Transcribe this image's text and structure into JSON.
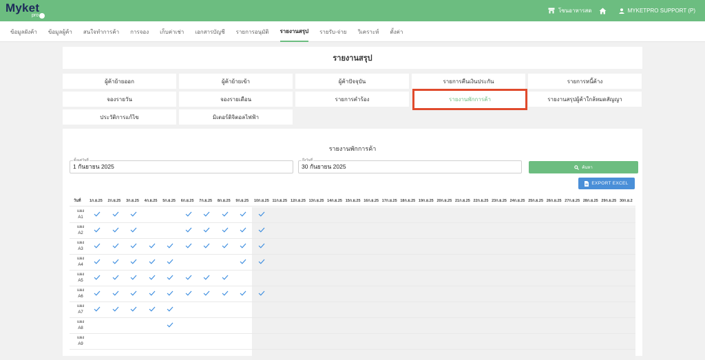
{
  "brand": {
    "name": "Myket",
    "sub": "pro"
  },
  "topbar": {
    "shop_label": "โซนอาหารสด",
    "user_label": "MYKETPRO SUPPORT (P)"
  },
  "nav": [
    "ข้อมูลผังค้า",
    "ข้อมูลผู้ค้า",
    "สนใจทำการค้า",
    "การจอง",
    "เก็บค่าเช่า",
    "เอกสารบัญชี",
    "รายการอนุมัติ",
    "รายงานสรุป",
    "รายรับ-จ่าย",
    "วิเคราะห์",
    "ตั้งค่า"
  ],
  "nav_active": 7,
  "page_title": "รายงานสรุป",
  "report_buttons": [
    "ผู้ค้าย้ายออก",
    "ผู้ค้าย้ายเข้า",
    "ผู้ค้าปัจจุบัน",
    "รายการคืนเงินประกัน",
    "รายการหนี้ค้าง",
    "จองรายวัน",
    "จองรายเดือน",
    "รายการคำร้อง",
    "รายงานพักการค้า",
    "รายงานสรุปผู้ค้าใกล้หมดสัญญา",
    "ประวัติการแก้ไข",
    "มิเตอร์ดิจิตอลไฟฟ้า"
  ],
  "report_selected": 8,
  "report": {
    "title": "รายงานพักการค้า",
    "start_label": "ตั้งแต่วันที่",
    "start_value": "1 กันยายน 2025",
    "end_label": "ถึงวันที่",
    "end_value": "30 กันยายน 2025",
    "search_label": "ค้นหา",
    "export_label": "EXPORT EXCEL"
  },
  "table": {
    "first_header": "วันที่",
    "days": [
      "1ก.ย.25",
      "2ก.ย.25",
      "3ก.ย.25",
      "4ก.ย.25",
      "5ก.ย.25",
      "6ก.ย.25",
      "7ก.ย.25",
      "8ก.ย.25",
      "9ก.ย.25",
      "10ก.ย.25",
      "11ก.ย.25",
      "12ก.ย.25",
      "13ก.ย.25",
      "14ก.ย.25",
      "15ก.ย.25",
      "16ก.ย.25",
      "17ก.ย.25",
      "18ก.ย.25",
      "19ก.ย.25",
      "20ก.ย.25",
      "21ก.ย.25",
      "22ก.ย.25",
      "23ก.ย.25",
      "24ก.ย.25",
      "25ก.ย.25",
      "26ก.ย.25",
      "27ก.ย.25",
      "28ก.ย.25",
      "29ก.ย.25",
      "30ก.ย.2"
    ],
    "rows": [
      {
        "prefix": "แผง",
        "name": "A1",
        "checks": [
          1,
          2,
          3,
          6,
          7,
          8,
          9,
          10
        ]
      },
      {
        "prefix": "แผง",
        "name": "A2",
        "checks": [
          1,
          2,
          3,
          6,
          7,
          8,
          9,
          10
        ]
      },
      {
        "prefix": "แผง",
        "name": "A3",
        "checks": [
          1,
          2,
          3,
          4,
          5,
          6,
          7,
          8,
          9,
          10
        ]
      },
      {
        "prefix": "แผง",
        "name": "A4",
        "checks": [
          1,
          2,
          3,
          4,
          5,
          9,
          10
        ]
      },
      {
        "prefix": "แผง",
        "name": "A5",
        "checks": [
          1,
          2,
          3,
          4,
          5,
          6,
          7,
          8
        ]
      },
      {
        "prefix": "แผง",
        "name": "A6",
        "checks": [
          1,
          2,
          3,
          4,
          5,
          6,
          7,
          8,
          9,
          10
        ]
      },
      {
        "prefix": "แผง",
        "name": "A7",
        "checks": [
          1,
          2,
          3,
          4,
          5
        ]
      },
      {
        "prefix": "แผง",
        "name": "A8",
        "checks": [
          5
        ]
      },
      {
        "prefix": "แผง",
        "name": "A9",
        "checks": []
      }
    ]
  },
  "colors": {
    "green": "#6cbd80",
    "blue": "#4a8fd8",
    "highlight": "#e04a2c",
    "check": "#3f8fe0"
  }
}
